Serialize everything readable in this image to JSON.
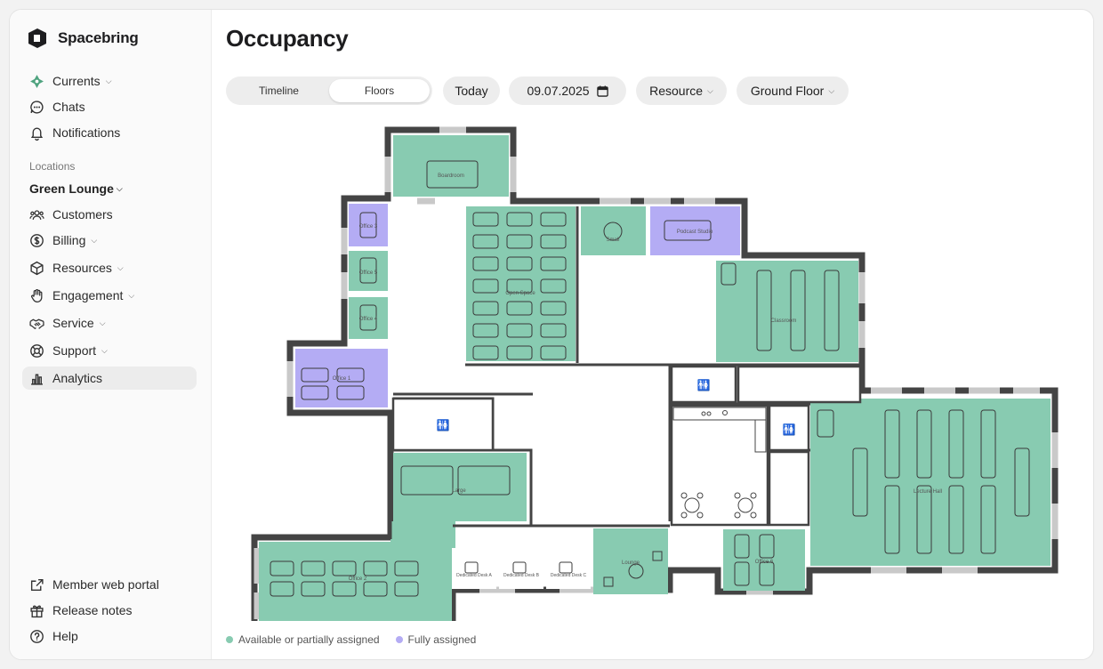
{
  "brand": {
    "name": "Spacebring"
  },
  "sidebar": {
    "top_items": [
      {
        "label": "Currents",
        "icon": "currents-icon",
        "has_caret": true
      },
      {
        "label": "Chats",
        "icon": "chat-icon"
      },
      {
        "label": "Notifications",
        "icon": "bell-icon"
      }
    ],
    "section_label": "Locations",
    "location": "Green Lounge",
    "items": [
      {
        "label": "Customers",
        "icon": "users-icon"
      },
      {
        "label": "Billing",
        "icon": "dollar-icon"
      },
      {
        "label": "Resources",
        "icon": "cube-icon"
      },
      {
        "label": "Engagement",
        "icon": "hand-icon"
      },
      {
        "label": "Service",
        "icon": "handshake-icon"
      },
      {
        "label": "Support",
        "icon": "lifebuoy-icon"
      },
      {
        "label": "Analytics",
        "icon": "chart-icon"
      }
    ],
    "bottom_items": [
      {
        "label": "Member web portal",
        "icon": "external-link-icon"
      },
      {
        "label": "Release notes",
        "icon": "gift-icon"
      },
      {
        "label": "Help",
        "icon": "help-icon"
      }
    ]
  },
  "page": {
    "title": "Occupancy"
  },
  "toolbar": {
    "tabs": [
      "Timeline",
      "Floors"
    ],
    "active_tab": "Floors",
    "today_label": "Today",
    "date_value": "09.07.2025",
    "resource_label": "Resource",
    "floor_label": "Ground Floor"
  },
  "rooms": {
    "boardroom": "Boardroom",
    "office3": "Office 3",
    "office5": "Office 5",
    "office4": "Office 4",
    "office1": "Office 1",
    "open_space": "Open Space",
    "small": "Small",
    "podcast": "Podcast Studio",
    "classroom": "Classroom",
    "large": "Large",
    "lecture_hall": "Lecture Hall",
    "office2": "Office 2",
    "desk_a": "Dedicated Desk A",
    "desk_b": "Dedicated Desk B",
    "desk_c": "Dedicated Desk C",
    "lounge": "Lounge",
    "office6": "Office 6"
  },
  "legend": {
    "available": "Available or partially assigned",
    "full": "Fully assigned"
  },
  "colors": {
    "available": "#88cbb1",
    "full": "#b4acf4",
    "wall": "#444444",
    "window": "#c8c8c8"
  }
}
